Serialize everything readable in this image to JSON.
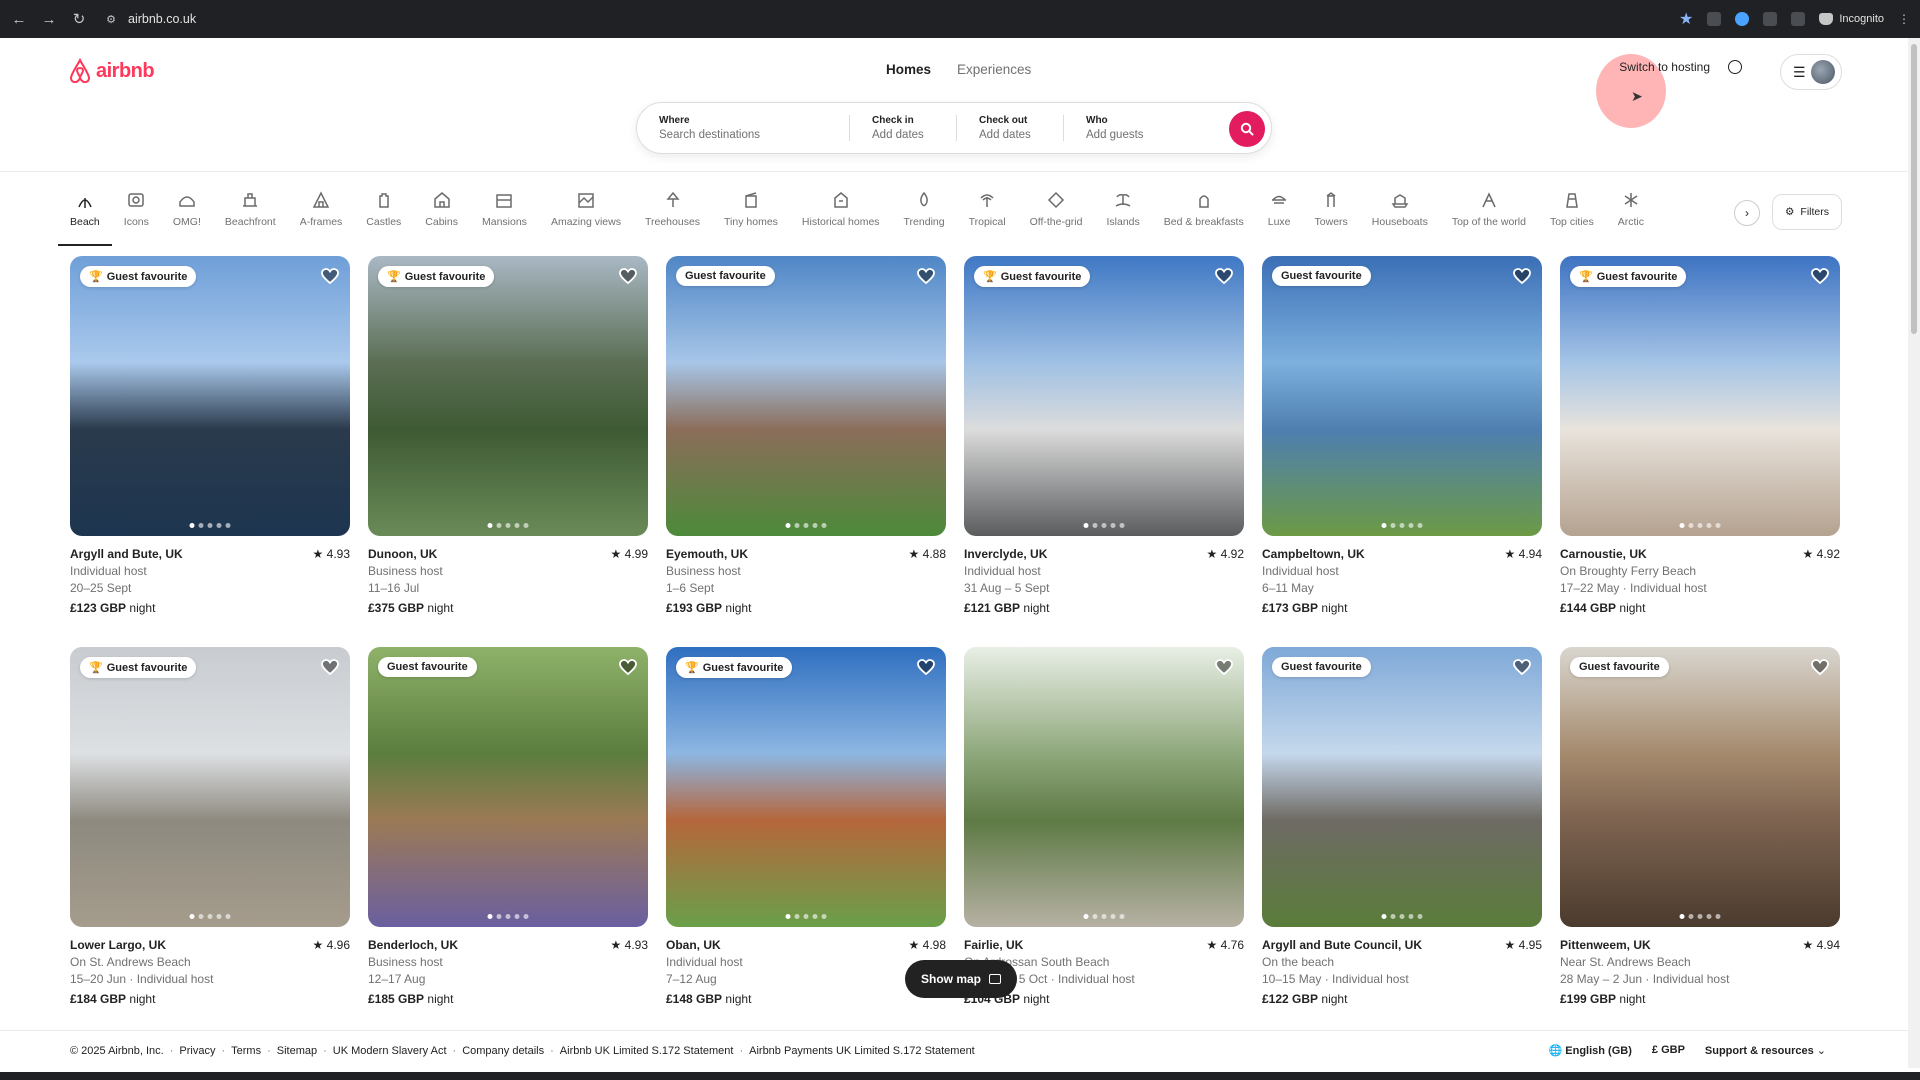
{
  "browser": {
    "url": "airbnb.co.uk",
    "incognito_label": "Incognito"
  },
  "header": {
    "logo_text": "airbnb",
    "nav": [
      "Homes",
      "Experiences"
    ],
    "switch_hosting": "Switch to hosting"
  },
  "search": {
    "where_label": "Where",
    "where_placeholder": "Search destinations",
    "checkin_label": "Check in",
    "checkin_value": "Add dates",
    "checkout_label": "Check out",
    "checkout_value": "Add dates",
    "who_label": "Who",
    "who_value": "Add guests"
  },
  "categories": [
    {
      "label": "Beach",
      "icon": "beach-icon"
    },
    {
      "label": "Icons",
      "icon": "icons-icon"
    },
    {
      "label": "OMG!",
      "icon": "omg-icon"
    },
    {
      "label": "Beachfront",
      "icon": "beachfront-icon"
    },
    {
      "label": "A-frames",
      "icon": "aframe-icon"
    },
    {
      "label": "Castles",
      "icon": "castle-icon"
    },
    {
      "label": "Cabins",
      "icon": "cabin-icon"
    },
    {
      "label": "Mansions",
      "icon": "mansion-icon"
    },
    {
      "label": "Amazing views",
      "icon": "views-icon"
    },
    {
      "label": "Treehouses",
      "icon": "treehouse-icon"
    },
    {
      "label": "Tiny homes",
      "icon": "tinyhome-icon"
    },
    {
      "label": "Historical homes",
      "icon": "historical-icon"
    },
    {
      "label": "Trending",
      "icon": "trending-icon"
    },
    {
      "label": "Tropical",
      "icon": "tropical-icon"
    },
    {
      "label": "Off-the-grid",
      "icon": "offgrid-icon"
    },
    {
      "label": "Islands",
      "icon": "island-icon"
    },
    {
      "label": "Bed & breakfasts",
      "icon": "bnb-icon"
    },
    {
      "label": "Luxe",
      "icon": "luxe-icon"
    },
    {
      "label": "Towers",
      "icon": "tower-icon"
    },
    {
      "label": "Houseboats",
      "icon": "houseboat-icon"
    },
    {
      "label": "Top of the world",
      "icon": "topworld-icon"
    },
    {
      "label": "Top cities",
      "icon": "topcities-icon"
    },
    {
      "label": "Arctic",
      "icon": "arctic-icon"
    }
  ],
  "filters_label": "Filters",
  "badge_text": "Guest favourite",
  "night_label": "night",
  "listings": [
    {
      "loc": "Argyll and Bute, UK",
      "rating": "★ 4.93",
      "line1": "Individual host",
      "line2": "20–25 Sept",
      "price": "£123 GBP",
      "badge": true,
      "trophy": true,
      "colors": [
        "#6f9fd8",
        "#aac9ec",
        "#2a3a4c",
        "#1d3550"
      ]
    },
    {
      "loc": "Dunoon, UK",
      "rating": "★ 4.99",
      "line1": "Business host",
      "line2": "11–16 Jul",
      "price": "£375 GBP",
      "badge": true,
      "trophy": true,
      "colors": [
        "#a9b8c4",
        "#5b6e54",
        "#3e5a34",
        "#6a8b58"
      ]
    },
    {
      "loc": "Eyemouth, UK",
      "rating": "★ 4.88",
      "line1": "Business host",
      "line2": "1–6 Sept",
      "price": "£193 GBP",
      "badge": true,
      "trophy": false,
      "colors": [
        "#4f86c6",
        "#a7c6e8",
        "#8b6d5a",
        "#4d8a3a"
      ]
    },
    {
      "loc": "Inverclyde, UK",
      "rating": "★ 4.92",
      "line1": "Individual host",
      "line2": "31 Aug – 5 Sept",
      "price": "£121 GBP",
      "badge": true,
      "trophy": true,
      "colors": [
        "#3f78c4",
        "#9fc0e4",
        "#dcdcdc",
        "#5a5c5e"
      ]
    },
    {
      "loc": "Campbeltown, UK",
      "rating": "★ 4.94",
      "line1": "Individual host",
      "line2": "6–11 May",
      "price": "£173 GBP",
      "badge": true,
      "trophy": false,
      "colors": [
        "#3b6fb6",
        "#7db0dd",
        "#4e7fb0",
        "#6c9a45"
      ]
    },
    {
      "loc": "Carnoustie, UK",
      "rating": "★ 4.92",
      "line1": "On Broughty Ferry Beach",
      "line2": "17–22 May · Individual host",
      "price": "£144 GBP",
      "badge": true,
      "trophy": true,
      "colors": [
        "#3d73c2",
        "#a5c4e6",
        "#e8e3dc",
        "#b5a290"
      ]
    },
    {
      "loc": "Lower Largo, UK",
      "rating": "★ 4.96",
      "line1": "On St. Andrews Beach",
      "line2": "15–20 Jun · Individual host",
      "price": "£184 GBP",
      "badge": true,
      "trophy": true,
      "colors": [
        "#c8ccd0",
        "#dde0e3",
        "#8e8a80",
        "#a59c8c"
      ]
    },
    {
      "loc": "Benderloch, UK",
      "rating": "★ 4.93",
      "line1": "Business host",
      "line2": "12–17 Aug",
      "price": "£185 GBP",
      "badge": true,
      "trophy": false,
      "colors": [
        "#8fb26a",
        "#5b7d3e",
        "#9c7a56",
        "#6a5fa0"
      ]
    },
    {
      "loc": "Oban, UK",
      "rating": "★ 4.98",
      "line1": "Individual host",
      "line2": "7–12 Aug",
      "price": "£148 GBP",
      "badge": true,
      "trophy": true,
      "colors": [
        "#2f6fc0",
        "#8db6e2",
        "#b5663b",
        "#6aa04a"
      ]
    },
    {
      "loc": "Fairlie, UK",
      "rating": "★ 4.76",
      "line1": "On Ardrossan South Beach",
      "line2": "30 Sept – 5 Oct · Individual host",
      "price": "£104 GBP",
      "badge": false,
      "trophy": false,
      "colors": [
        "#e9efe6",
        "#8fa87c",
        "#5e7a45",
        "#b7b1a4"
      ]
    },
    {
      "loc": "Argyll and Bute Council, UK",
      "rating": "★ 4.95",
      "line1": "On the beach",
      "line2": "10–15 May · Individual host",
      "price": "£122 GBP",
      "badge": true,
      "trophy": false,
      "colors": [
        "#7fa9d8",
        "#c5d8ec",
        "#6e6a64",
        "#5a7d3a"
      ]
    },
    {
      "loc": "Pittenweem, UK",
      "rating": "★ 4.94",
      "line1": "Near St. Andrews Beach",
      "line2": "28 May – 2 Jun · Individual host",
      "price": "£199 GBP",
      "badge": true,
      "trophy": false,
      "colors": [
        "#d9d6cf",
        "#a58a6d",
        "#7d6350",
        "#4b3b2e"
      ]
    }
  ],
  "show_map": "Show map",
  "footer": {
    "links": [
      "© 2025 Airbnb, Inc.",
      "Privacy",
      "Terms",
      "Sitemap",
      "UK Modern Slavery Act",
      "Company details",
      "Airbnb UK Limited S.172 Statement",
      "Airbnb Payments UK Limited S.172 Statement"
    ],
    "language": "English (GB)",
    "currency": "£  GBP",
    "support": "Support & resources"
  },
  "theme": {
    "brand": "#ff385c",
    "search_button": "#e31c5f"
  }
}
